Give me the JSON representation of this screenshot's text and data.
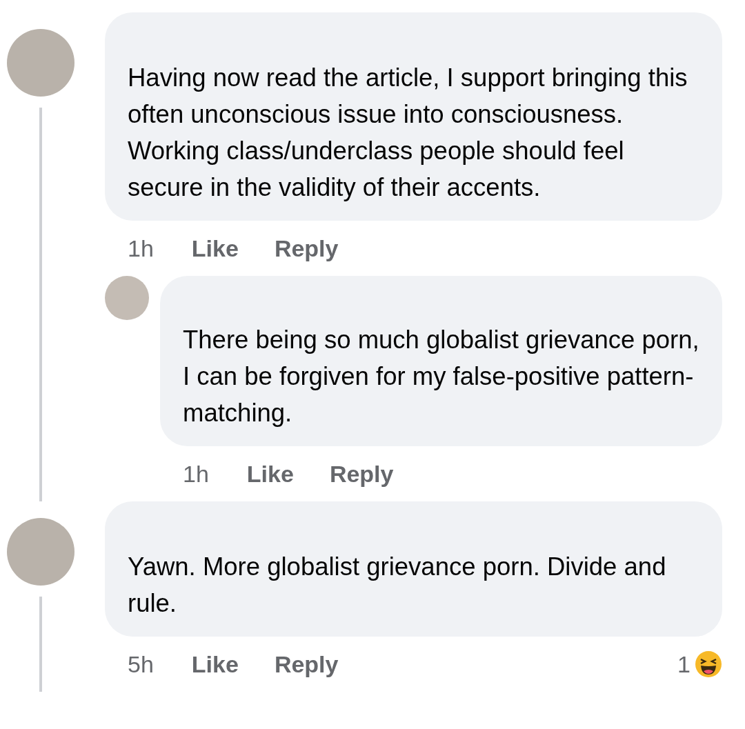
{
  "comments": [
    {
      "text": "Having now read the article, I support bringing this often unconscious issue into consciousness. Working class/underclass people should feel secure in the validity of their accents.",
      "time": "1h",
      "like": "Like",
      "reply": "Reply",
      "replies": [
        {
          "text": "There being so much globalist grievance porn, I can be forgiven for my false-positive pattern-matching.",
          "time": "1h",
          "like": "Like",
          "reply": "Reply"
        }
      ]
    },
    {
      "text": "Yawn. More globalist grievance porn. Divide and rule.",
      "time": "5h",
      "like": "Like",
      "reply": "Reply",
      "reactions": {
        "count": "1"
      }
    }
  ]
}
